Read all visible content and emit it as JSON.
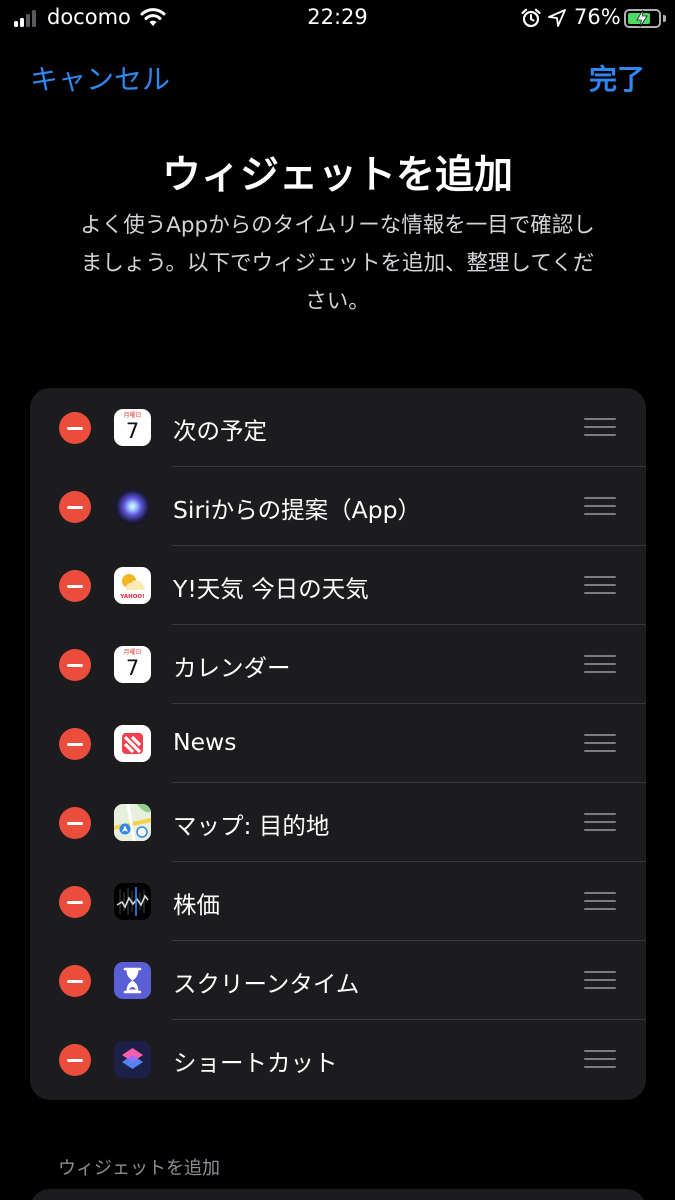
{
  "status": {
    "carrier": "docomo",
    "time": "22:29",
    "battery": "76%",
    "battery_level": 0.76,
    "signal_bars": 2,
    "icons": [
      "signal-icon",
      "wifi-icon",
      "alarm-icon",
      "location-icon",
      "battery-icon"
    ]
  },
  "nav": {
    "cancel": "キャンセル",
    "done": "完了"
  },
  "header": {
    "title": "ウィジェットを追加",
    "desc_lines": [
      "よく使うAppからのタイムリーな情報を一目で確認し",
      "ましょう。以下でウィジェットを追加、整理してくだ",
      "さい。"
    ]
  },
  "widgets": [
    {
      "label": "次の予定",
      "icon": "calendar-icon",
      "cal_dow": "月曜日",
      "cal_day": "7"
    },
    {
      "label": "Siriからの提案（App）",
      "icon": "siri-icon"
    },
    {
      "label": "Y!天気 今日の天気",
      "icon": "yahoo-weather-icon",
      "icon_text": "YAHOO!"
    },
    {
      "label": "カレンダー",
      "icon": "calendar-icon",
      "cal_dow": "月曜日",
      "cal_day": "7"
    },
    {
      "label": "News",
      "icon": "news-icon"
    },
    {
      "label": "マップ: 目的地",
      "icon": "maps-icon"
    },
    {
      "label": "株価",
      "icon": "stocks-icon"
    },
    {
      "label": "スクリーンタイム",
      "icon": "screen-time-icon"
    },
    {
      "label": "ショートカット",
      "icon": "shortcuts-icon"
    }
  ],
  "section_more": "ウィジェットを追加",
  "colors": {
    "accent": "#2f87f0",
    "remove": "#eb4d3d",
    "card": "#1c1c1e",
    "background": "#000000",
    "battery_charging": "#4cd964"
  }
}
